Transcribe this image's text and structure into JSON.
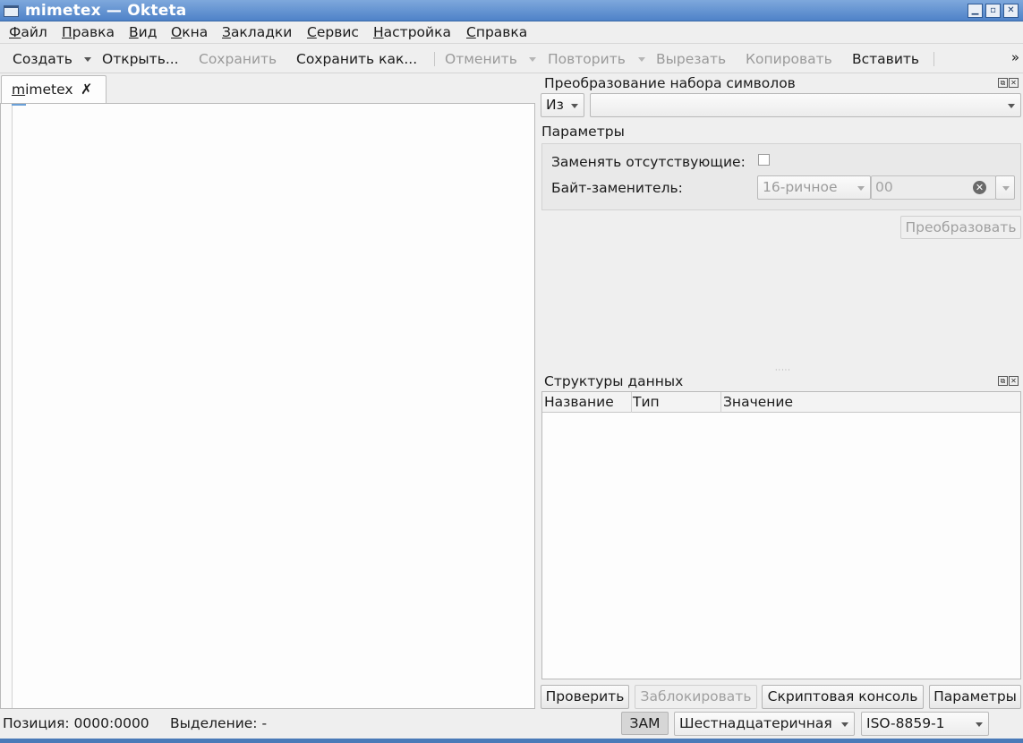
{
  "window": {
    "title": "mimetex  — Okteta",
    "min_glyph": "▁",
    "max_glyph": "▫",
    "close_glyph": "✕"
  },
  "menu": [
    {
      "first": "Ф",
      "rest": "айл"
    },
    {
      "first": "П",
      "rest": "равка"
    },
    {
      "first": "В",
      "rest": "ид"
    },
    {
      "first": "О",
      "rest": "кна"
    },
    {
      "first": "З",
      "rest": "акладки"
    },
    {
      "first": "С",
      "rest": "ервис"
    },
    {
      "first": "Н",
      "rest": "астройка"
    },
    {
      "first": "С",
      "rest": "правка"
    }
  ],
  "toolbar": {
    "create": "Создать",
    "open": "Открыть...",
    "save": "Сохранить",
    "save_as": "Сохранить как...",
    "undo": "Отменить",
    "redo": "Повторить",
    "cut": "Вырезать",
    "copy": "Копировать",
    "paste": "Вставить",
    "more": "»"
  },
  "tab": {
    "first": "m",
    "rest": "imetex",
    "close": "✗"
  },
  "charset_panel": {
    "title": "Преобразование набора символов",
    "direction": "Из",
    "charset_value": "",
    "params_heading": "Параметры",
    "replace_missing_label": "Заменять отсутствующие:",
    "replace_missing_checked": false,
    "substitute_label": "Байт-заменитель:",
    "base_value": "16-ричное",
    "byte_value": "00",
    "convert_button": "Преобразовать"
  },
  "structures_panel": {
    "title": "Структуры данных",
    "columns": [
      "Название",
      "Тип",
      "Значение"
    ],
    "rows": [],
    "buttons": {
      "validate": "Проверить",
      "lock": "Заблокировать",
      "script_console": "Скриптовая консоль",
      "settings": "Параметры"
    }
  },
  "status": {
    "position": "Позиция: 0000:0000",
    "selection": "Выделение: -",
    "mode": "ЗАМ",
    "value_coding": "Шестнадцатеричная",
    "char_coding": "ISO-8859-1"
  },
  "dock_buttons": {
    "float": "⧉",
    "close": "✕"
  }
}
